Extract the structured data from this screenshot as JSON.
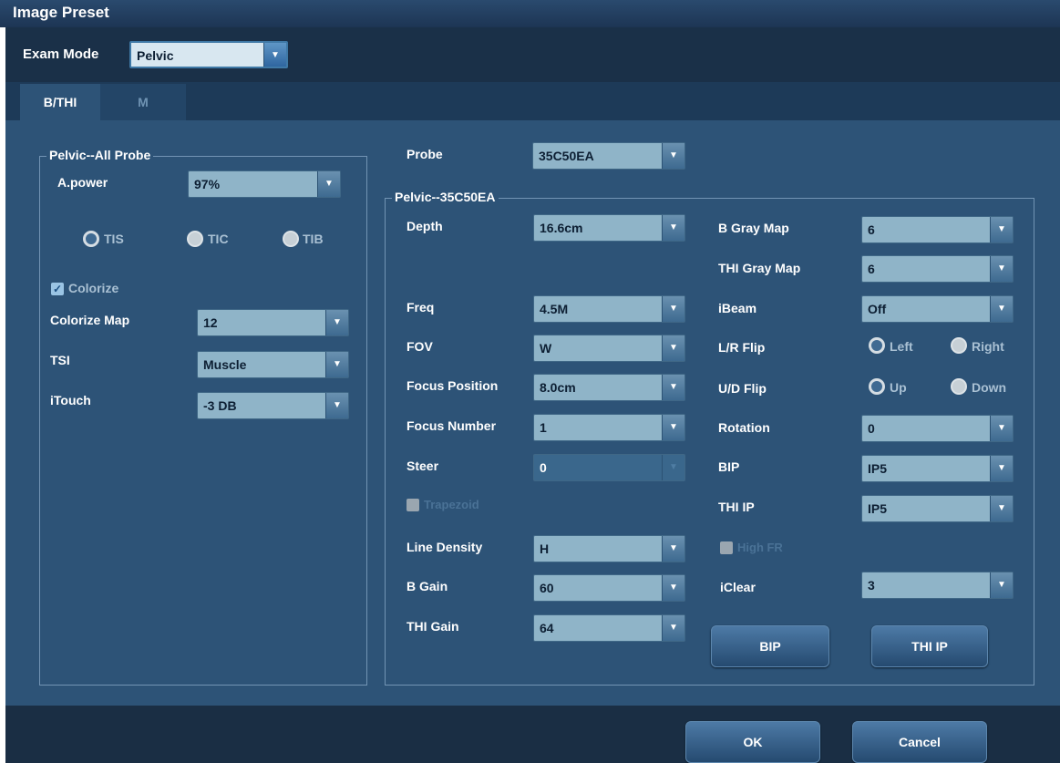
{
  "window": {
    "title": "Image Preset"
  },
  "exam_mode": {
    "label": "Exam Mode",
    "value": "Pelvic"
  },
  "tabs": [
    {
      "label": "B/THI",
      "active": true
    },
    {
      "label": "M",
      "active": false
    }
  ],
  "all_probe": {
    "title": "Pelvic--All Probe",
    "apower": {
      "label": "A.power",
      "value": "97%"
    },
    "radios": [
      {
        "label": "TIS",
        "selected": true
      },
      {
        "label": "TIC",
        "selected": false
      },
      {
        "label": "TIB",
        "selected": false
      }
    ],
    "colorize": {
      "label": "Colorize",
      "checked": true
    },
    "colorize_map": {
      "label": "Colorize Map",
      "value": "12"
    },
    "tsi": {
      "label": "TSI",
      "value": "Muscle"
    },
    "itouch": {
      "label": "iTouch",
      "value": "-3 DB"
    }
  },
  "probe": {
    "label": "Probe",
    "value": "35C50EA"
  },
  "probe_group": {
    "title": "Pelvic--35C50EA",
    "depth": {
      "label": "Depth",
      "value": "16.6cm"
    },
    "freq": {
      "label": "Freq",
      "value": "4.5M"
    },
    "fov": {
      "label": "FOV",
      "value": "W"
    },
    "focus_position": {
      "label": "Focus Position",
      "value": "8.0cm"
    },
    "focus_number": {
      "label": "Focus Number",
      "value": "1"
    },
    "steer": {
      "label": "Steer",
      "value": "0"
    },
    "trapezoid": {
      "label": "Trapezoid",
      "checked": false,
      "enabled": false
    },
    "line_density": {
      "label": "Line Density",
      "value": "H"
    },
    "b_gain": {
      "label": "B Gain",
      "value": "60"
    },
    "thi_gain": {
      "label": "THI Gain",
      "value": "64"
    },
    "b_gray_map": {
      "label": "B Gray Map",
      "value": "6"
    },
    "thi_gray_map": {
      "label": "THI Gray Map",
      "value": "6"
    },
    "ibeam": {
      "label": "iBeam",
      "value": "Off"
    },
    "lr_flip": {
      "label": "L/R Flip",
      "options": [
        {
          "label": "Left",
          "selected": true
        },
        {
          "label": "Right",
          "selected": false
        }
      ]
    },
    "ud_flip": {
      "label": "U/D Flip",
      "options": [
        {
          "label": "Up",
          "selected": true
        },
        {
          "label": "Down",
          "selected": false
        }
      ]
    },
    "rotation": {
      "label": "Rotation",
      "value": "0"
    },
    "bip": {
      "label": "BIP",
      "value": "IP5"
    },
    "thi_ip": {
      "label": "THI IP",
      "value": "IP5"
    },
    "high_fr": {
      "label": "High FR",
      "checked": false,
      "enabled": false
    },
    "iclear": {
      "label": "iClear",
      "value": "3"
    },
    "bip_button": "BIP",
    "thi_ip_button": "THI IP"
  },
  "footer": {
    "ok": "OK",
    "cancel": "Cancel"
  }
}
